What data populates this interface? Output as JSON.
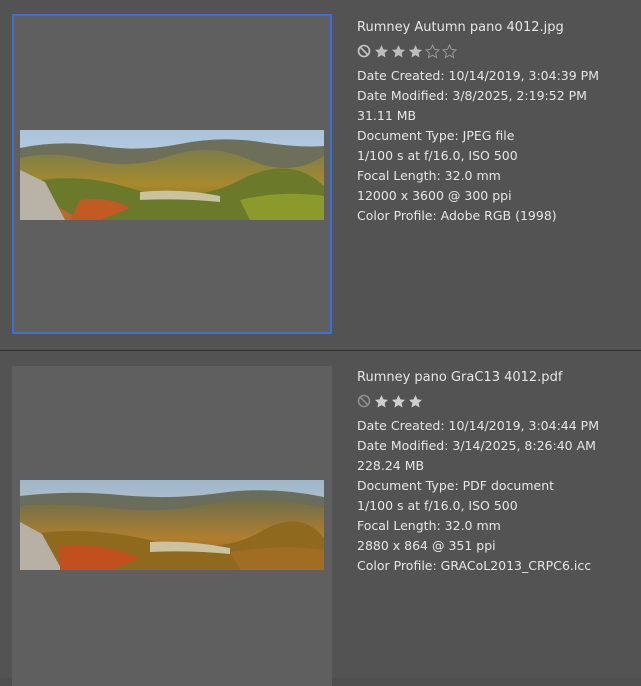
{
  "items": [
    {
      "filename": "Rumney Autumn pano 4012.jpg",
      "rating": 3,
      "stars_shown": 5,
      "date_created": "Date Created: 10/14/2019, 3:04:39 PM",
      "date_modified": "Date Modified: 3/8/2025, 2:19:52 PM",
      "size": "31.11 MB",
      "doc_type": "Document Type: JPEG file",
      "exposure": "1/100 s at f/16.0, ISO 500",
      "focal": "Focal Length: 32.0 mm",
      "dimensions": "12000 x 3600 @ 300 ppi",
      "color_profile": "Color Profile: Adobe RGB (1998)",
      "selected": true
    },
    {
      "filename": "Rumney pano GraC13 4012.pdf",
      "rating": 3,
      "stars_shown": 3,
      "date_created": "Date Created: 10/14/2019, 3:04:44 PM",
      "date_modified": "Date Modified: 3/14/2025, 8:26:40 AM",
      "size": "228.24 MB",
      "doc_type": "Document Type: PDF document",
      "exposure": "1/100 s at f/16.0, ISO 500",
      "focal": "Focal Length: 32.0 mm",
      "dimensions": "2880 x 864 @ 351 ppi",
      "color_profile": "Color Profile: GRACoL2013_CRPC6.icc",
      "selected": false
    }
  ],
  "colors": {
    "selection_border": "#3e6fd6",
    "star_filled": "#bdbdbd",
    "star_empty": "#8a8a8a"
  },
  "icons": {
    "reject": "no-symbol-icon",
    "star": "star-icon"
  }
}
